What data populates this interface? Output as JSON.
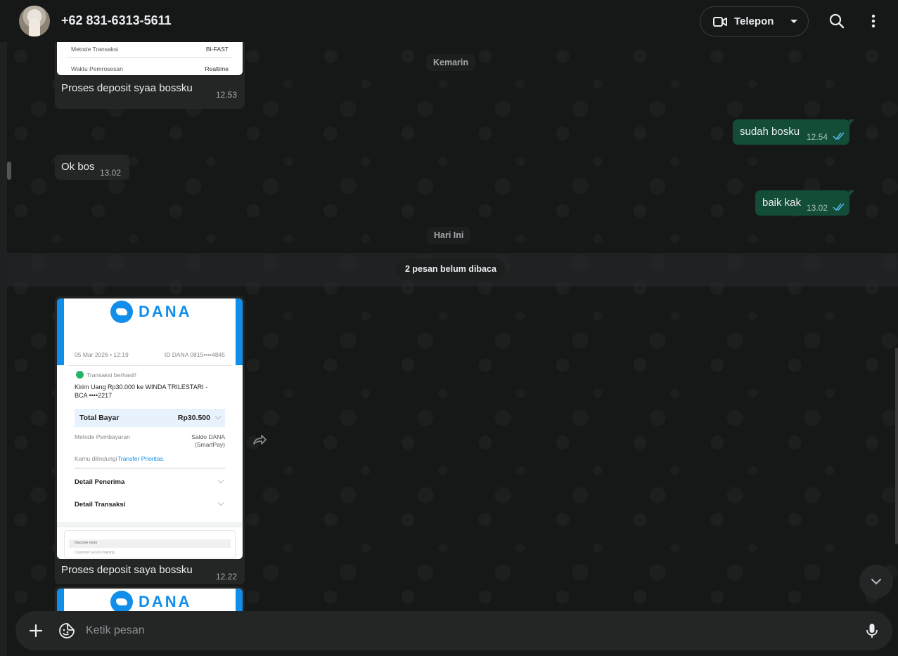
{
  "header": {
    "contact_name": "+62 831-6313-5611",
    "call_label": "Telepon"
  },
  "dividers": {
    "yesterday": "Kemarin",
    "today": "Hari Ini",
    "unread": "2 pesan belum dibaca"
  },
  "receipt_top": {
    "row1_label": "Metode Transaksi",
    "row1_value": "BI-FAST",
    "row2_label": "Waktu Pemrosesan",
    "row2_value": "Realtime"
  },
  "messages": [
    {
      "text": "Proses deposit syaa bossku",
      "time": "12.53"
    },
    {
      "text": "sudah bosku",
      "time": "12.54"
    },
    {
      "text": "Ok bos",
      "time": "13.02"
    },
    {
      "text": "baik kak",
      "time": "13.02"
    },
    {
      "text": "Proses deposit saya bossku",
      "time": "12.22"
    }
  ],
  "receipt": {
    "brand": "DANA",
    "date": "05 Mar 2026 • 12:19",
    "id": "ID DANA 0815••••4845",
    "status": "Transaksi berhasil!",
    "desc1": "Kirim Uang Rp30.000 ke WINDA TRILESTARI -",
    "desc2": "BCA ••••2217",
    "total_label": "Total Bayar",
    "total_value": "Rp30.500",
    "method_label": "Metode Pembayaran",
    "method_value1": "Saldo DANA",
    "method_value2": "(SmartPay)",
    "protected_prefix": "Kamu dilindungi",
    "protected_link": "Transfer Prioritas.",
    "detail_recipient": "Detail Penerima",
    "detail_transaction": "Detail Transaksi",
    "discover": "Discover more",
    "support": "Customer service training"
  },
  "composer": {
    "placeholder": "Ketik pesan"
  },
  "colors": {
    "outgoing_bubble": "#144d37",
    "incoming_bubble": "#242626",
    "read_ticks": "#53bdeb",
    "dana_blue": "#118eea"
  }
}
